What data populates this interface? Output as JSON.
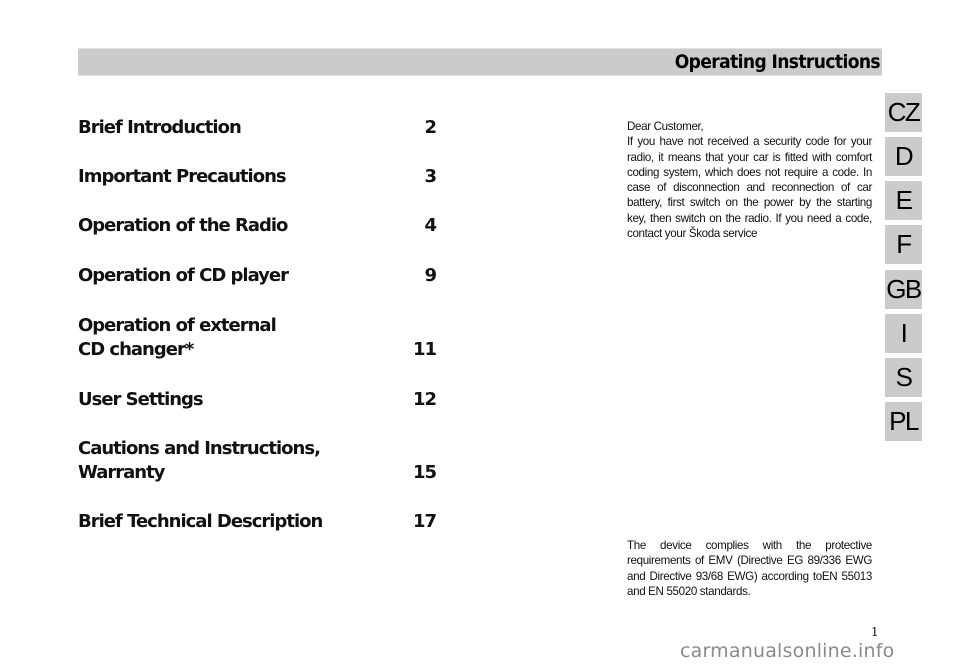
{
  "header": {
    "title": "Operating Instructions"
  },
  "toc": {
    "entries": [
      {
        "title": "Brief Introduction",
        "page": "2"
      },
      {
        "title": "Important Precautions",
        "page": "3"
      },
      {
        "title": "Operation of the Radio",
        "page": "4"
      },
      {
        "title": "Operation of CD player",
        "page": "9"
      },
      {
        "title": "Operation of external\nCD changer*",
        "page": "11"
      },
      {
        "title": "User Settings",
        "page": "12"
      },
      {
        "title": "Cautions and Instructions,\nWarranty",
        "page": "15"
      },
      {
        "title": "Brief Technical Description",
        "page": "17"
      }
    ]
  },
  "security_notice": {
    "greeting": "Dear Customer,",
    "body": "If you have not received a security code for your radio, it means that your car is fitted with comfort coding system, which does not require a code. In case of disconnection and reconnection of car battery, first switch on the power by the starting key, then switch on the radio. If you need a code, contact your Škoda service"
  },
  "compliance_notice": {
    "text": "The device complies with the protective requirements of EMV (Directive EG 89/336 EWG and Directive 93/68 EWG) according toEN 55013 and EN 55020 standards."
  },
  "language_tabs": [
    "CZ",
    "D",
    "E",
    "F",
    "GB",
    "I",
    "S",
    "PL"
  ],
  "page_number": "1",
  "watermark": "carmanualsonline.info"
}
